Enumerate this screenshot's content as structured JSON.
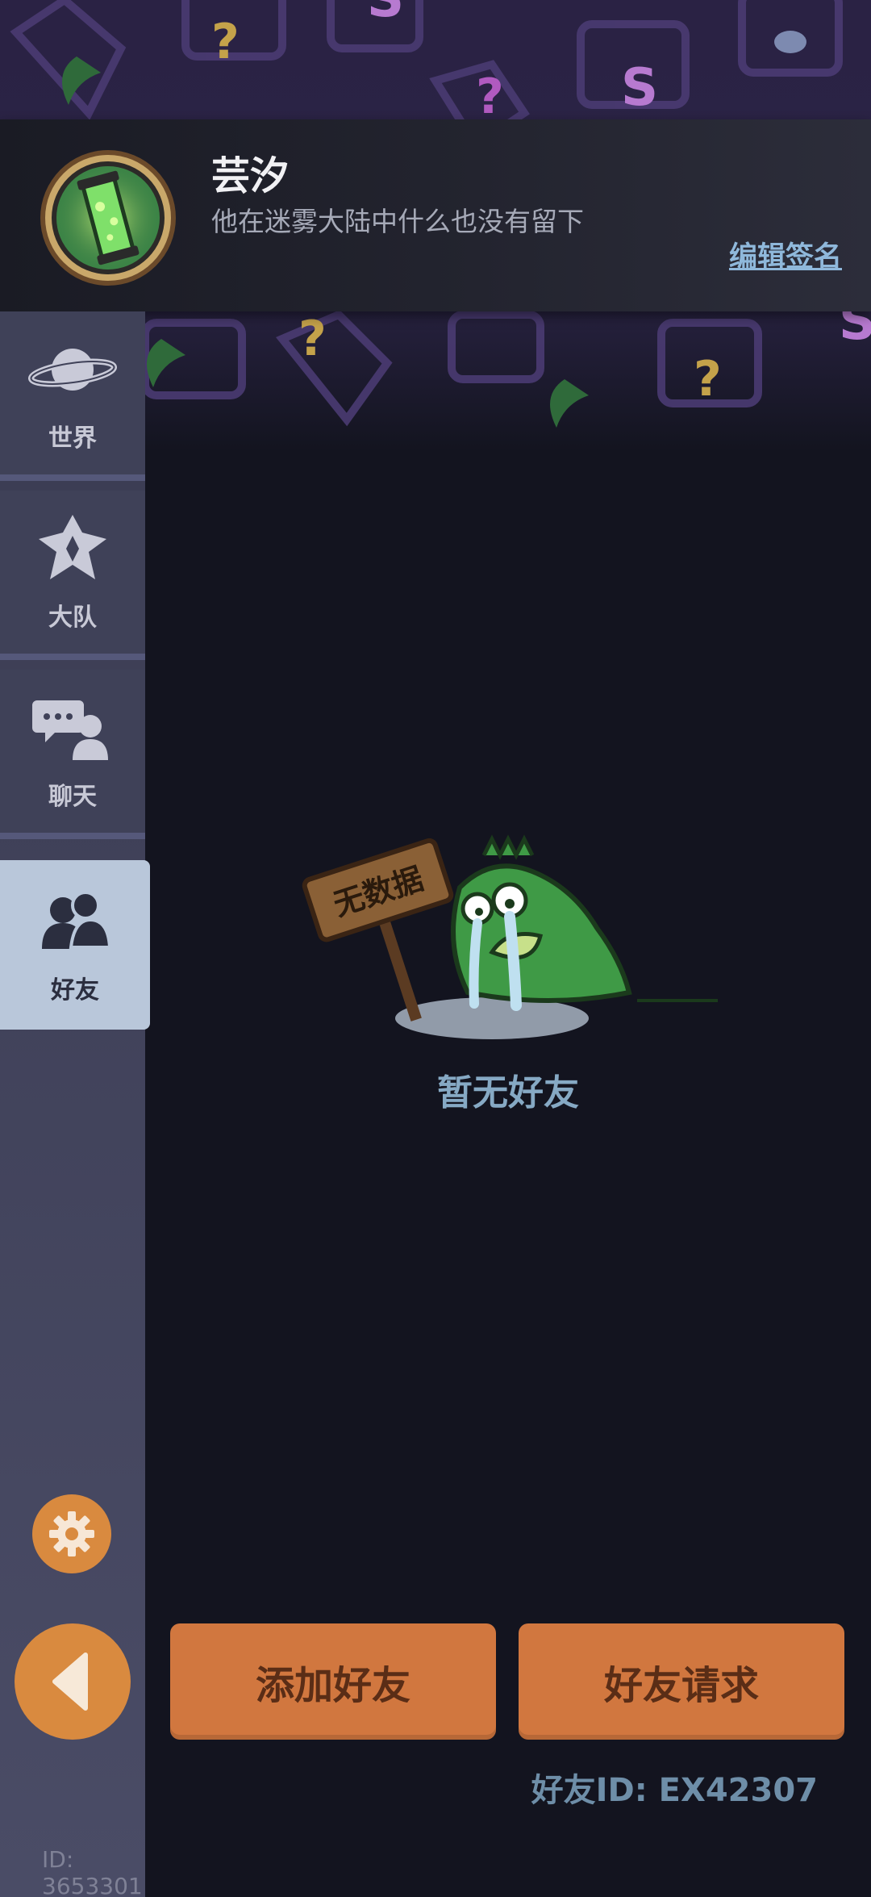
{
  "header": {
    "user_name": "芸汐",
    "signature": "他在迷雾大陆中什么也没有留下",
    "edit_signature_label": "编辑签名",
    "avatar_icon": "green-potion-tube-icon"
  },
  "sidebar": {
    "items": [
      {
        "label": "世界",
        "icon": "planet-icon"
      },
      {
        "label": "大队",
        "icon": "team-crest-icon"
      },
      {
        "label": "聊天",
        "icon": "chat-bubbles-icon"
      },
      {
        "label": "好友",
        "icon": "friends-icon",
        "active": true
      }
    ],
    "settings_icon": "gear-icon",
    "back_icon": "back-arrow-icon"
  },
  "empty_state": {
    "sign_text": "无数据",
    "message": "暂无好友"
  },
  "actions": {
    "add_friend": "添加好友",
    "friend_requests": "好友请求"
  },
  "friend_id": "好友ID: EX42307",
  "user_id": "ID: 3653301",
  "colors": {
    "accent_orange": "#d1773f",
    "active_tab": "#b9c7da",
    "background": "#13141f"
  }
}
